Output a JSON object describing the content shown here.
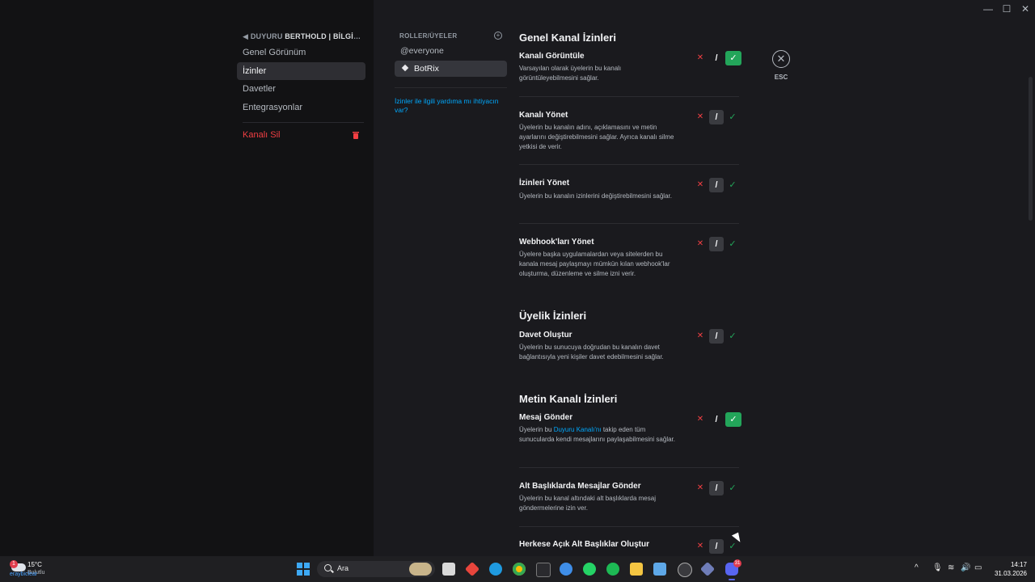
{
  "window": {
    "minimize": "—",
    "maximize": "☐",
    "close": "✕"
  },
  "sidebar": {
    "category_prefix": "DUYURU",
    "category_channel": "BERTHOLD | BİLGİLENDİ...",
    "items": [
      {
        "label": "Genel Görünüm",
        "active": false
      },
      {
        "label": "İzinler",
        "active": true
      },
      {
        "label": "Davetler",
        "active": false
      },
      {
        "label": "Entegrasyonlar",
        "active": false
      }
    ],
    "delete_label": "Kanalı Sil"
  },
  "roles": {
    "header": "ROLLER/ÜYELER",
    "add_symbol": "+",
    "items": [
      {
        "label": "@everyone",
        "active": false
      },
      {
        "label": "BotRix",
        "active": true
      }
    ],
    "help_text": "İzinler ile ilgili yardıma mı ihtiyacın var?"
  },
  "sections": [
    {
      "title": "Genel Kanal İzinleri"
    },
    {
      "title": "Üyelik İzinleri"
    },
    {
      "title": "Metin Kanalı İzinleri"
    }
  ],
  "permissions": [
    {
      "title": "Kanalı Görüntüle",
      "desc": "Varsayılan olarak üyelerin bu kanalı görüntüleyebilmesini sağlar.",
      "state": "allow"
    },
    {
      "title": "Kanalı Yönet",
      "desc": "Üyelerin bu kanalın adını, açıklamasını ve metin ayarlarını değiştirebilmesini sağlar. Ayrıca kanalı silme yetkisi de verir.",
      "state": "neutral"
    },
    {
      "title": "İzinleri Yönet",
      "desc": "Üyelerin bu kanalın izinlerini değiştirebilmesini sağlar.",
      "state": "neutral"
    },
    {
      "title": "Webhook'ları Yönet",
      "desc": "Üyelere başka uygulamalardan veya sitelerden bu kanala mesaj paylaşmayı mümkün kılan webhook'lar oluşturma, düzenleme ve silme izni verir.",
      "state": "neutral"
    },
    {
      "title": "Davet Oluştur",
      "desc": "Üyelerin bu sunucuya doğrudan bu kanalın davet bağlantısıyla yeni kişiler davet edebilmesini sağlar.",
      "state": "neutral"
    },
    {
      "title": "Mesaj Gönder",
      "desc_before": "Üyelerin bu ",
      "desc_link": "Duyuru Kanalı'nı",
      "desc_after": " takip eden tüm sunucularda kendi mesajlarını paylaşabilmesini sağlar.",
      "state": "allow"
    },
    {
      "title": "Alt Başlıklarda Mesajlar Gönder",
      "desc": "Üyelerin bu kanal altındaki alt başlıklarda mesaj göndermelerine izin ver.",
      "state": "neutral"
    },
    {
      "title": "Herkese Açık Alt Başlıklar Oluştur",
      "desc": "",
      "state": "neutral"
    }
  ],
  "toggle_symbols": {
    "deny": "✕",
    "neutral": "/",
    "allow": "✓"
  },
  "close": {
    "symbol": "✕",
    "label": "ESC"
  },
  "taskbar": {
    "weather_temp": "15°C",
    "weather_desc": "Bulutlu",
    "weather_badge": "1",
    "weather_mini": "eraybiclear",
    "search_placeholder": "Ara",
    "discord_badge": "31",
    "time": "14:17",
    "date": "31.03.2026",
    "tray_chevron": "^"
  }
}
